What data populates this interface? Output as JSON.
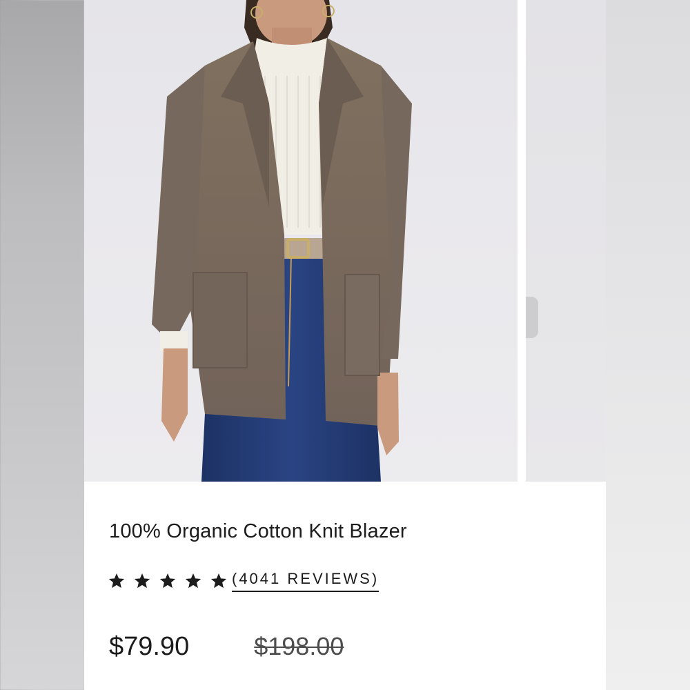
{
  "product": {
    "title": "100% Organic Cotton Knit Blazer",
    "rating": {
      "stars_filled": 5,
      "stars_total": 5,
      "reviews_label": "(4041 REVIEWS)"
    },
    "price_current": "$79.90",
    "price_original": "$198.00"
  },
  "images": {
    "main": "product-photo-model-wearing-brown-knit-blazer",
    "next": "next-product-photo-partial"
  },
  "colors": {
    "text": "#1c1c1c",
    "strike_price": "#4d4d4d",
    "star": "#1c1c1c",
    "blazer": "#7a6a5e",
    "jeans": "#22396e",
    "turtleneck": "#f1eee6"
  },
  "icons": {
    "star": "star-icon"
  }
}
